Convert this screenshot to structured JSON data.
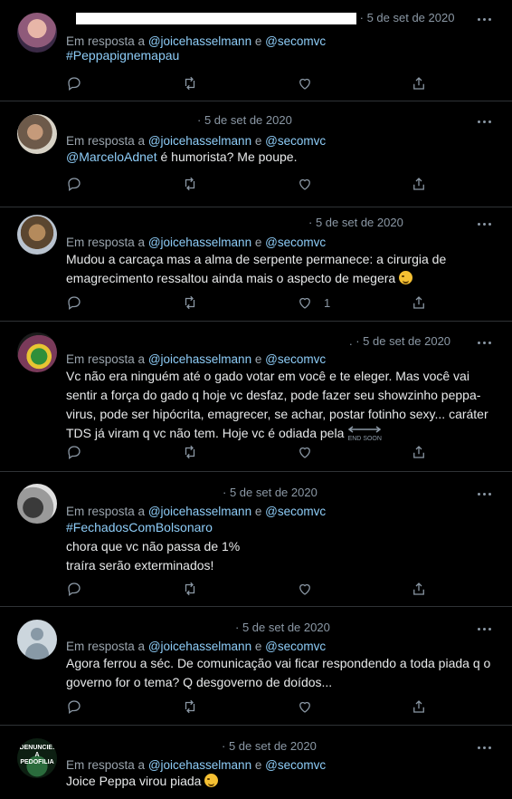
{
  "tweets": [
    {
      "date": "5 de set de 2020",
      "reply_prefix": "Em resposta a",
      "mention1": "@joicehasselmann",
      "reply_joiner": "e",
      "mention2": "@secomvc",
      "line1": "#Peppapignemapau",
      "like_count": ""
    },
    {
      "date": "5 de set de 2020",
      "reply_prefix": "Em resposta a",
      "mention1": "@joicehasselmann",
      "reply_joiner": "e",
      "mention2": "@secomvc",
      "line1_link": "@MarceloAdnet",
      "line1_rest": " é humorista? Me poupe.",
      "like_count": ""
    },
    {
      "date": "5 de set de 2020",
      "reply_prefix": "Em resposta a",
      "mention1": "@joicehasselmann",
      "reply_joiner": "e",
      "mention2": "@secomvc",
      "line1": "Mudou a carcaça mas a alma de serpente permanece: a cirurgia de",
      "line2": "emagrecimento ressaltou ainda mais o aspecto de megera",
      "like_count": "1"
    },
    {
      "date": "5 de set de 2020",
      "reply_prefix": "Em resposta a",
      "mention1": "@joicehasselmann",
      "reply_joiner": "e",
      "mention2": "@secomvc",
      "line1": "Vc não era ninguém até o gado votar em você e te eleger. Mas você vai",
      "line2": "sentir a força do gado  q hoje vc desfaz, pode fazer seu showzinho peppa-",
      "line3": "virus, pode ser hipócrita, emagrecer, se achar, postar fotinho sexy... caráter",
      "line4": "TDS já viram q vc não tem. Hoje vc é odiada pela",
      "end_soon_top": "END",
      "end_soon_bottom": "SOON",
      "like_count": ""
    },
    {
      "date": "5 de set de 2020",
      "reply_prefix": "Em resposta a",
      "mention1": "@joicehasselmann",
      "reply_joiner": "e",
      "mention2": "@secomvc",
      "line1": "#FechadosComBolsonaro",
      "line2": "chora que vc não passa de 1%",
      "line3": "traíra serão exterminados!",
      "like_count": ""
    },
    {
      "date": "5 de set de 2020",
      "reply_prefix": "Em resposta a",
      "mention1": "@joicehasselmann",
      "reply_joiner": "e",
      "mention2": "@secomvc",
      "line1": "Agora ferrou a séc. De comunicação vai ficar respondendo a toda piada q o",
      "line2": "governo for o tema? Q desgoverno de doídos...",
      "like_count": ""
    },
    {
      "date": "5 de set de 2020",
      "reply_prefix": "Em resposta a",
      "mention1": "@joicehasselmann",
      "reply_joiner": "e",
      "mention2": "@secomvc",
      "line1": "Joice Peppa virou piada",
      "avatar_text_top": "DENUNCIE:",
      "avatar_text_bottom": "A PEDOFILIA",
      "like_count": ""
    }
  ],
  "icons": [
    "reply-icon",
    "retweet-icon",
    "like-icon",
    "share-icon",
    "more-icon",
    "default-avatar-icon",
    "grinning-emoji-icon",
    "end-soon-arrow-icon"
  ],
  "colors": {
    "background": "#000000",
    "link": "#8ecdf8",
    "muted": "#8b98a5",
    "divider": "#2f3336"
  }
}
